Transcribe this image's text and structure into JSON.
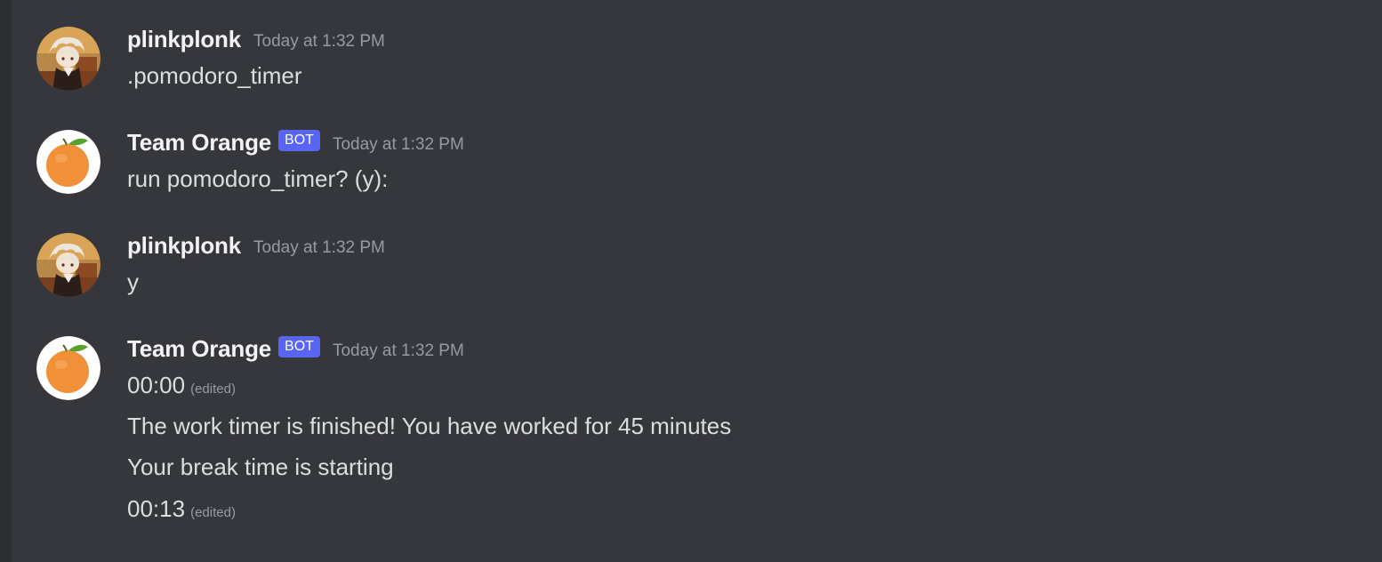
{
  "messages": [
    {
      "author": "plinkplonk",
      "is_bot": false,
      "timestamp": "Today at 1:32 PM",
      "avatar_icon": "anime-character-avatar",
      "lines": [
        ".pomodoro_timer"
      ]
    },
    {
      "author": "Team Orange",
      "is_bot": true,
      "bot_tag": "BOT",
      "timestamp": "Today at 1:32 PM",
      "avatar_icon": "orange-fruit-avatar",
      "lines": [
        "run pomodoro_timer? (y):"
      ]
    },
    {
      "author": "plinkplonk",
      "is_bot": false,
      "timestamp": "Today at 1:32 PM",
      "avatar_icon": "anime-character-avatar",
      "lines": [
        "y"
      ]
    },
    {
      "author": "Team Orange",
      "is_bot": true,
      "bot_tag": "BOT",
      "timestamp": "Today at 1:32 PM",
      "avatar_icon": "orange-fruit-avatar",
      "lines": [
        {
          "text": "00:00",
          "edited": "(edited)"
        },
        {
          "text": "The work timer is finished! You have worked for 45 minutes"
        },
        {
          "text": "Your break time is starting"
        },
        {
          "text": "00:13",
          "edited": "(edited)"
        }
      ]
    }
  ],
  "colors": {
    "background": "#36373d",
    "username": "#f2f3f5",
    "message_text": "#dbdee1",
    "timestamp": "#949ba4",
    "bot_tag": "#5865f2",
    "orange": "#f0913a",
    "leaf": "#5aa02c"
  }
}
